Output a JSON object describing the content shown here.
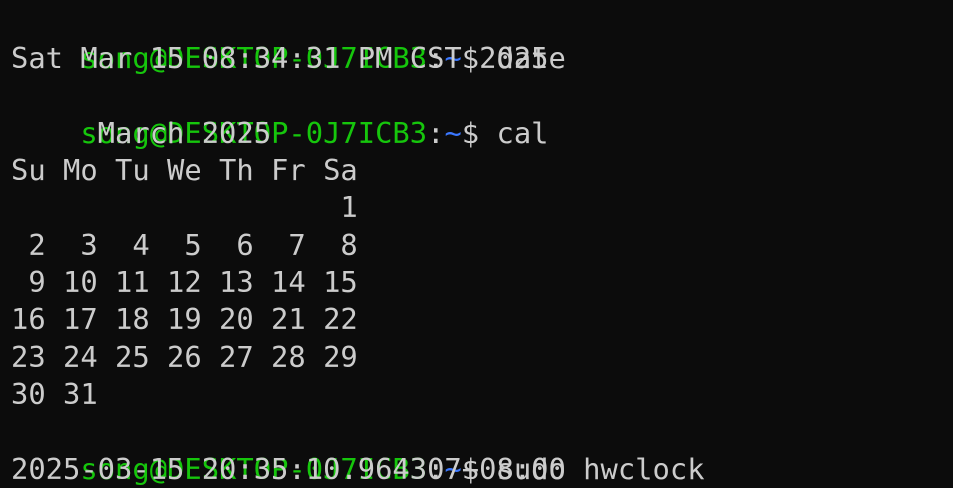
{
  "terminal": {
    "prompt": {
      "user_host": "song@DESKTOP-0J7ICB3",
      "colon": ":",
      "cwd": "~",
      "symbol": "$ "
    },
    "colors": {
      "background": "#0c0c0c",
      "prompt_user": "#16c60c",
      "prompt_path": "#3b78ff",
      "text": "#cccccc"
    },
    "session": [
      {
        "command": "date",
        "output": [
          "Sat Mar 15 08:34:31 PM CST 2025"
        ]
      },
      {
        "command": "cal",
        "output": [
          "     March 2025",
          "Su Mo Tu We Th Fr Sa",
          "                   1",
          " 2  3  4  5  6  7  8",
          " 9 10 11 12 13 14 15",
          "16 17 18 19 20 21 22",
          "23 24 25 26 27 28 29",
          "30 31"
        ]
      },
      {
        "command": "sudo hwclock",
        "output": [
          "2025-03-15 20:35:10.964307+08:00"
        ]
      }
    ]
  }
}
